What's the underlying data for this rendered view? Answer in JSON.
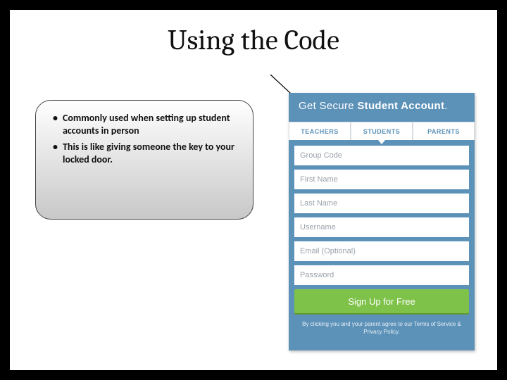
{
  "slide": {
    "title": "Using the Code",
    "bullets": [
      "Commonly used when setting up student accounts in person",
      "This is like giving someone the key to your locked door."
    ]
  },
  "signup_panel": {
    "heading_prefix": "Get Secure ",
    "heading_bold": "Student Account",
    "heading_suffix": ".",
    "tabs": {
      "teachers": "TEACHERS",
      "students": "STUDENTS",
      "parents": "PARENTS"
    },
    "fields": {
      "group_code": "Group Code",
      "first_name": "First Name",
      "last_name": "Last Name",
      "username": "Username",
      "email": "Email (Optional)",
      "password": "Password"
    },
    "button": "Sign Up for Free",
    "fineprint": "By clicking you and your parent agree to our Terms of Service & Privacy Policy."
  }
}
